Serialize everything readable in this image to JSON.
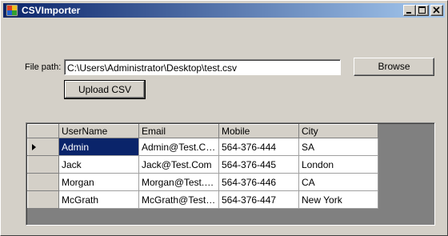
{
  "window": {
    "title": "CSVImporter",
    "colors": {
      "title_bar": "#0a246a",
      "background": "#d4d0c8",
      "selection": "#0a246a"
    }
  },
  "form": {
    "file_path_label": "File path:",
    "file_path_value": "C:\\Users\\Administrator\\Desktop\\test.csv",
    "browse_label": "Browse",
    "upload_label": "Upload CSV"
  },
  "grid": {
    "columns": [
      "UserName",
      "Email",
      "Mobile",
      "City"
    ],
    "rows": [
      {
        "current": true,
        "cells": [
          "Admin",
          "Admin@Test.Com",
          "564-376-444",
          "SA"
        ]
      },
      {
        "current": false,
        "cells": [
          "Jack",
          "Jack@Test.Com",
          "564-376-445",
          "London"
        ]
      },
      {
        "current": false,
        "cells": [
          "Morgan",
          "Morgan@Test.Com",
          "564-376-446",
          "CA"
        ]
      },
      {
        "current": false,
        "cells": [
          "McGrath",
          "McGrath@Test.C...",
          "564-376-447",
          "New York"
        ]
      }
    ]
  }
}
